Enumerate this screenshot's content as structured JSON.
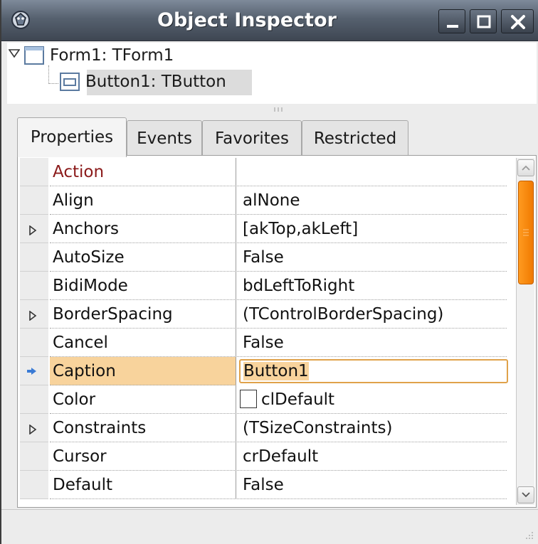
{
  "window": {
    "title": "Object Inspector",
    "icon": "lazarus-icon",
    "controls": [
      "minimize-icon",
      "maximize-icon",
      "close-icon"
    ]
  },
  "tree": {
    "items": [
      {
        "label": "Form1: TForm1",
        "icon": "form-icon",
        "expanded": true
      },
      {
        "label": "Button1: TButton",
        "icon": "button-component-icon",
        "selected": true
      }
    ]
  },
  "tabs": [
    {
      "label": "Properties",
      "active": true
    },
    {
      "label": "Events",
      "active": false
    },
    {
      "label": "Favorites",
      "active": false
    },
    {
      "label": "Restricted",
      "active": false
    }
  ],
  "properties": [
    {
      "name": "Action",
      "value": ""
    },
    {
      "name": "Align",
      "value": "alNone"
    },
    {
      "name": "Anchors",
      "value": "[akTop,akLeft]",
      "expandable": true
    },
    {
      "name": "AutoSize",
      "value": "False"
    },
    {
      "name": "BidiMode",
      "value": "bdLeftToRight"
    },
    {
      "name": "BorderSpacing",
      "value": "(TControlBorderSpacing)",
      "expandable": true
    },
    {
      "name": "Cancel",
      "value": "False"
    },
    {
      "name": "Caption",
      "value": "Button1",
      "selected": true,
      "editing": true
    },
    {
      "name": "Color",
      "value": "clDefault",
      "swatch": "#ffffff"
    },
    {
      "name": "Constraints",
      "value": "(TSizeConstraints)",
      "expandable": true
    },
    {
      "name": "Cursor",
      "value": "crDefault"
    },
    {
      "name": "Default",
      "value": "False"
    }
  ],
  "colors": {
    "title_bar": "#56616f",
    "selected_property": "#f8d39c",
    "edit_border": "#e0a24a",
    "scroll_thumb": "#f58a10",
    "action_text": "#8b1a1a"
  }
}
